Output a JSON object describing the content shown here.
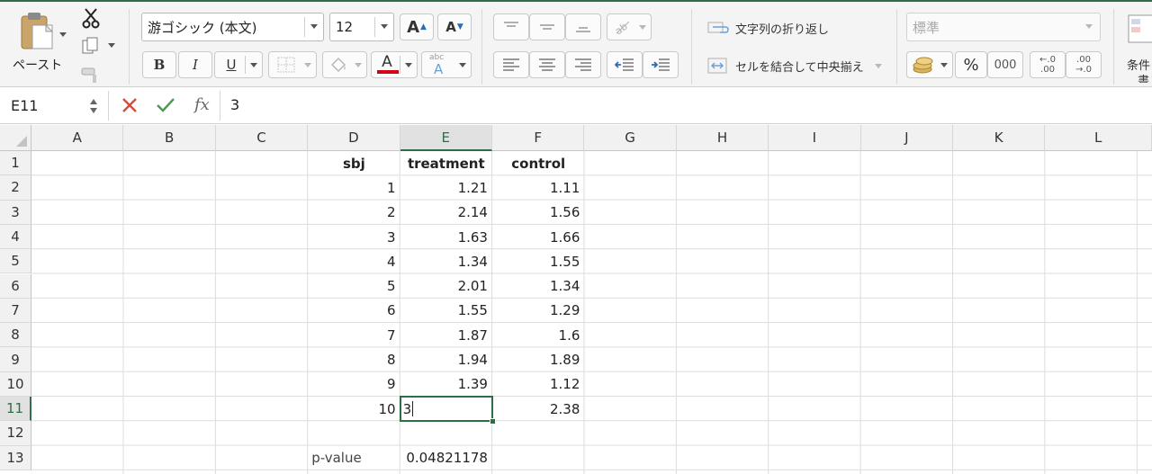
{
  "ribbon": {
    "clipboard": {
      "paste_label": "ペースト"
    },
    "font": {
      "font_name": "游ゴシック (本文)",
      "font_size": "12",
      "grow_label": "A",
      "shrink_label": "A",
      "bold_label": "B",
      "italic_label": "I",
      "underline_label": "U",
      "font_color_label": "A",
      "phonetic_label": "abc",
      "phonetic_sub": "A",
      "font_color_bar": "#d0021b"
    },
    "alignment": {
      "wrap_text_label": "文字列の折り返し",
      "merge_center_label": "セルを結合して中央揃え"
    },
    "number": {
      "format_value": "標準",
      "percent_label": "%",
      "comma_label": "000",
      "inc_decimal_top": "←.0",
      "inc_decimal_bottom": ".00",
      "dec_decimal_top": ".00",
      "dec_decimal_bottom": "→.0"
    },
    "styles": {
      "cond_format_line1": "条件",
      "cond_format_line2": "書"
    }
  },
  "formula_bar": {
    "name_box": "E11",
    "fx_label": "fx",
    "value": "3"
  },
  "grid": {
    "columns": [
      "A",
      "B",
      "C",
      "D",
      "E",
      "F",
      "G",
      "H",
      "I",
      "J",
      "K",
      "L"
    ],
    "rows": [
      "1",
      "2",
      "3",
      "4",
      "5",
      "6",
      "7",
      "8",
      "9",
      "10",
      "11",
      "12",
      "13"
    ],
    "headers": {
      "sbj": "sbj",
      "treatment": "treatment",
      "control": "control"
    },
    "data": [
      {
        "sbj": "1",
        "treatment": "1.21",
        "control": "1.11"
      },
      {
        "sbj": "2",
        "treatment": "2.14",
        "control": "1.56"
      },
      {
        "sbj": "3",
        "treatment": "1.63",
        "control": "1.66"
      },
      {
        "sbj": "4",
        "treatment": "1.34",
        "control": "1.55"
      },
      {
        "sbj": "5",
        "treatment": "2.01",
        "control": "1.34"
      },
      {
        "sbj": "6",
        "treatment": "1.55",
        "control": "1.29"
      },
      {
        "sbj": "7",
        "treatment": "1.87",
        "control": "1.6"
      },
      {
        "sbj": "8",
        "treatment": "1.94",
        "control": "1.89"
      },
      {
        "sbj": "9",
        "treatment": "1.39",
        "control": "1.12"
      },
      {
        "sbj": "10",
        "treatment": "3",
        "control": "2.38"
      }
    ],
    "pvalue_label": "p-value",
    "pvalue": "0.04821178",
    "active_cell": "E11",
    "accent_color": "#2e6e46"
  }
}
